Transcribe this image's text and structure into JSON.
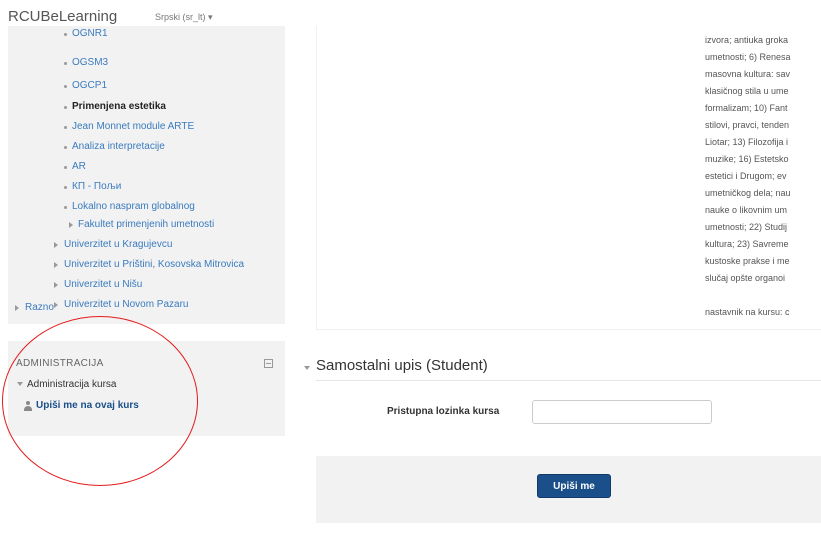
{
  "header": {
    "brand": "RCUBeLearning",
    "language": "Srpski (sr_lt) ▾"
  },
  "nav": {
    "courses": [
      "OGNR1",
      "OGSM3",
      "OGCP1",
      "Primenjena estetika",
      "Jean Monnet module ARTE",
      "Analiza interpretacije",
      "AR",
      "КП - Пољи",
      "Lokalno naspram globalnog"
    ],
    "faculty": "Fakultet primenjenih umetnosti",
    "universities": [
      "Univerzitet u Kragujevcu",
      "Univerzitet u Prištini, Kosovska Mitrovica",
      "Univerzitet u Nišu",
      "Univerzitet u Novom Pazaru"
    ],
    "misc": "Razno"
  },
  "admin": {
    "title": "ADMINISTRACIJA",
    "course_admin": "Administracija kursa",
    "enrol_link": "Upiši me na ovaj kurs"
  },
  "summary": {
    "lines": [
      "izvora; antiuka groka",
      "umetnosti; 6) Renesa",
      "masovna kultura: sav",
      "klasičnog stila u ume",
      "formalizam; 10) Fant",
      "stilovi, pravci, tenden",
      "Liotar; 13) Filozofija i",
      "muzike; 16) Estetsko",
      "estetici i Drugom; ev",
      "umetničkog dela; nau",
      "nauke o likovnim um",
      "umetnosti; 22) Studij",
      "kultura; 23) Savreme",
      "kustoske prakse i me",
      "slučaj opšte organoi"
    ],
    "teacher": "nastavnik na kursu: c"
  },
  "enrol": {
    "section_title": "Samostalni upis (Student)",
    "password_label": "Pristupna lozinka kursa",
    "password_value": "",
    "submit_label": "Upiši me"
  }
}
